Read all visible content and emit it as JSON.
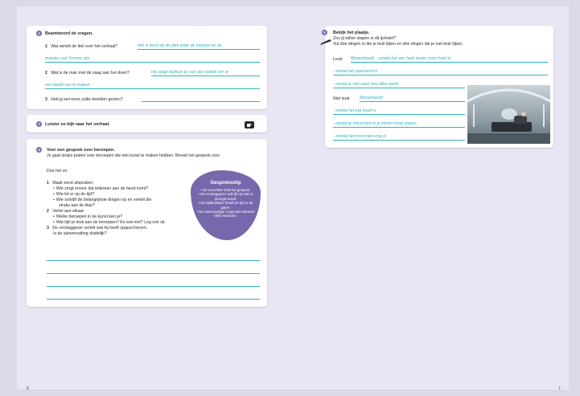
{
  "q2": {
    "badge": "2",
    "title": "Beantwoord de vragen.",
    "items": [
      {
        "n": "1",
        "q": "Wat vertelt de titel over het verhaal?",
        "a1": "Het is koud op de plek waar de meisjes en de",
        "a2": "moeder van Yvonne zijn."
      },
      {
        "n": "2",
        "q": "Wat is de man met de zaag aan het doen?",
        "a1": "Hij zaagt stukken ijs van een ijsblok om er",
        "a2": "een beeld van te maken."
      },
      {
        "n": "3",
        "q": "Heb jij wel eens zulke beelden gezien?",
        "a1": ""
      }
    ]
  },
  "q3": {
    "badge": "3",
    "title": "Luister en kijk naar het verhaal."
  },
  "q4": {
    "badge": "4",
    "title": "Voer een gesprek over beroepen.",
    "intro": "Je gaat straks praten over beroepen die met kunst te maken hebben. Bereid het gesprek voor.",
    "doe": "Doe het zo:",
    "s1": {
      "n": "1",
      "text": "Maak eerst afspraken:",
      "bullets": [
        "Wie zorgt ervoor dat iedereen aan de beurt komt?",
        "Wie let er op de tijd?",
        "Wie schrijft de belangrijkste dingen op en vertelt die",
        "straks aan de klas?"
      ]
    },
    "s2": {
      "n": "2",
      "text": "Vertel aan elkaar:",
      "bullets": [
        "Welke beroepen in de kunst ken je?",
        "Wat lijkt je leuk aan de beroepen? En wat niet? Leg ook uit."
      ]
    },
    "s3": {
      "n": "3",
      "text": "De verslaggever vertelt wat hij heeft opgeschreven.",
      "text2": "Is de samenvatting duidelijk?"
    }
  },
  "tip": {
    "title": "Gespreksstip",
    "items": [
      "• De voorzitter leidt het gesprek.",
      "• De verslaggever schrijft op wat er gezegd wordt.",
      "• De tijdbewaker houdt de tijd in de gaten.",
      "• De aanmoediger zorgt dat iedereen blijft meedoen."
    ]
  },
  "q5": {
    "badge": "5",
    "title": "Bekijk het plaatje.",
    "l1": "Zou jij willen slapen in dit ijshotel?",
    "l2": "Vul drie dingen in die je leuk lijken en drie dingen die je niet leuk lijken.",
    "leuk_label": "Leuk:",
    "leuk": [
      "Bijvoorbeeld: - omdat het een heel ander soort hotel is",
      "- omdat het spannend is",
      "- omdat je niet weet hoe alles werkt."
    ],
    "niet_label": "Niet leuk:",
    "niet": [
      "Bijvoorbeeld:",
      "- omdat het erg koud is",
      "- omdat je misschien in je kleren moet slapen",
      "- omdat het misschien eng is"
    ]
  },
  "pages": {
    "left": "6",
    "right": "7"
  }
}
